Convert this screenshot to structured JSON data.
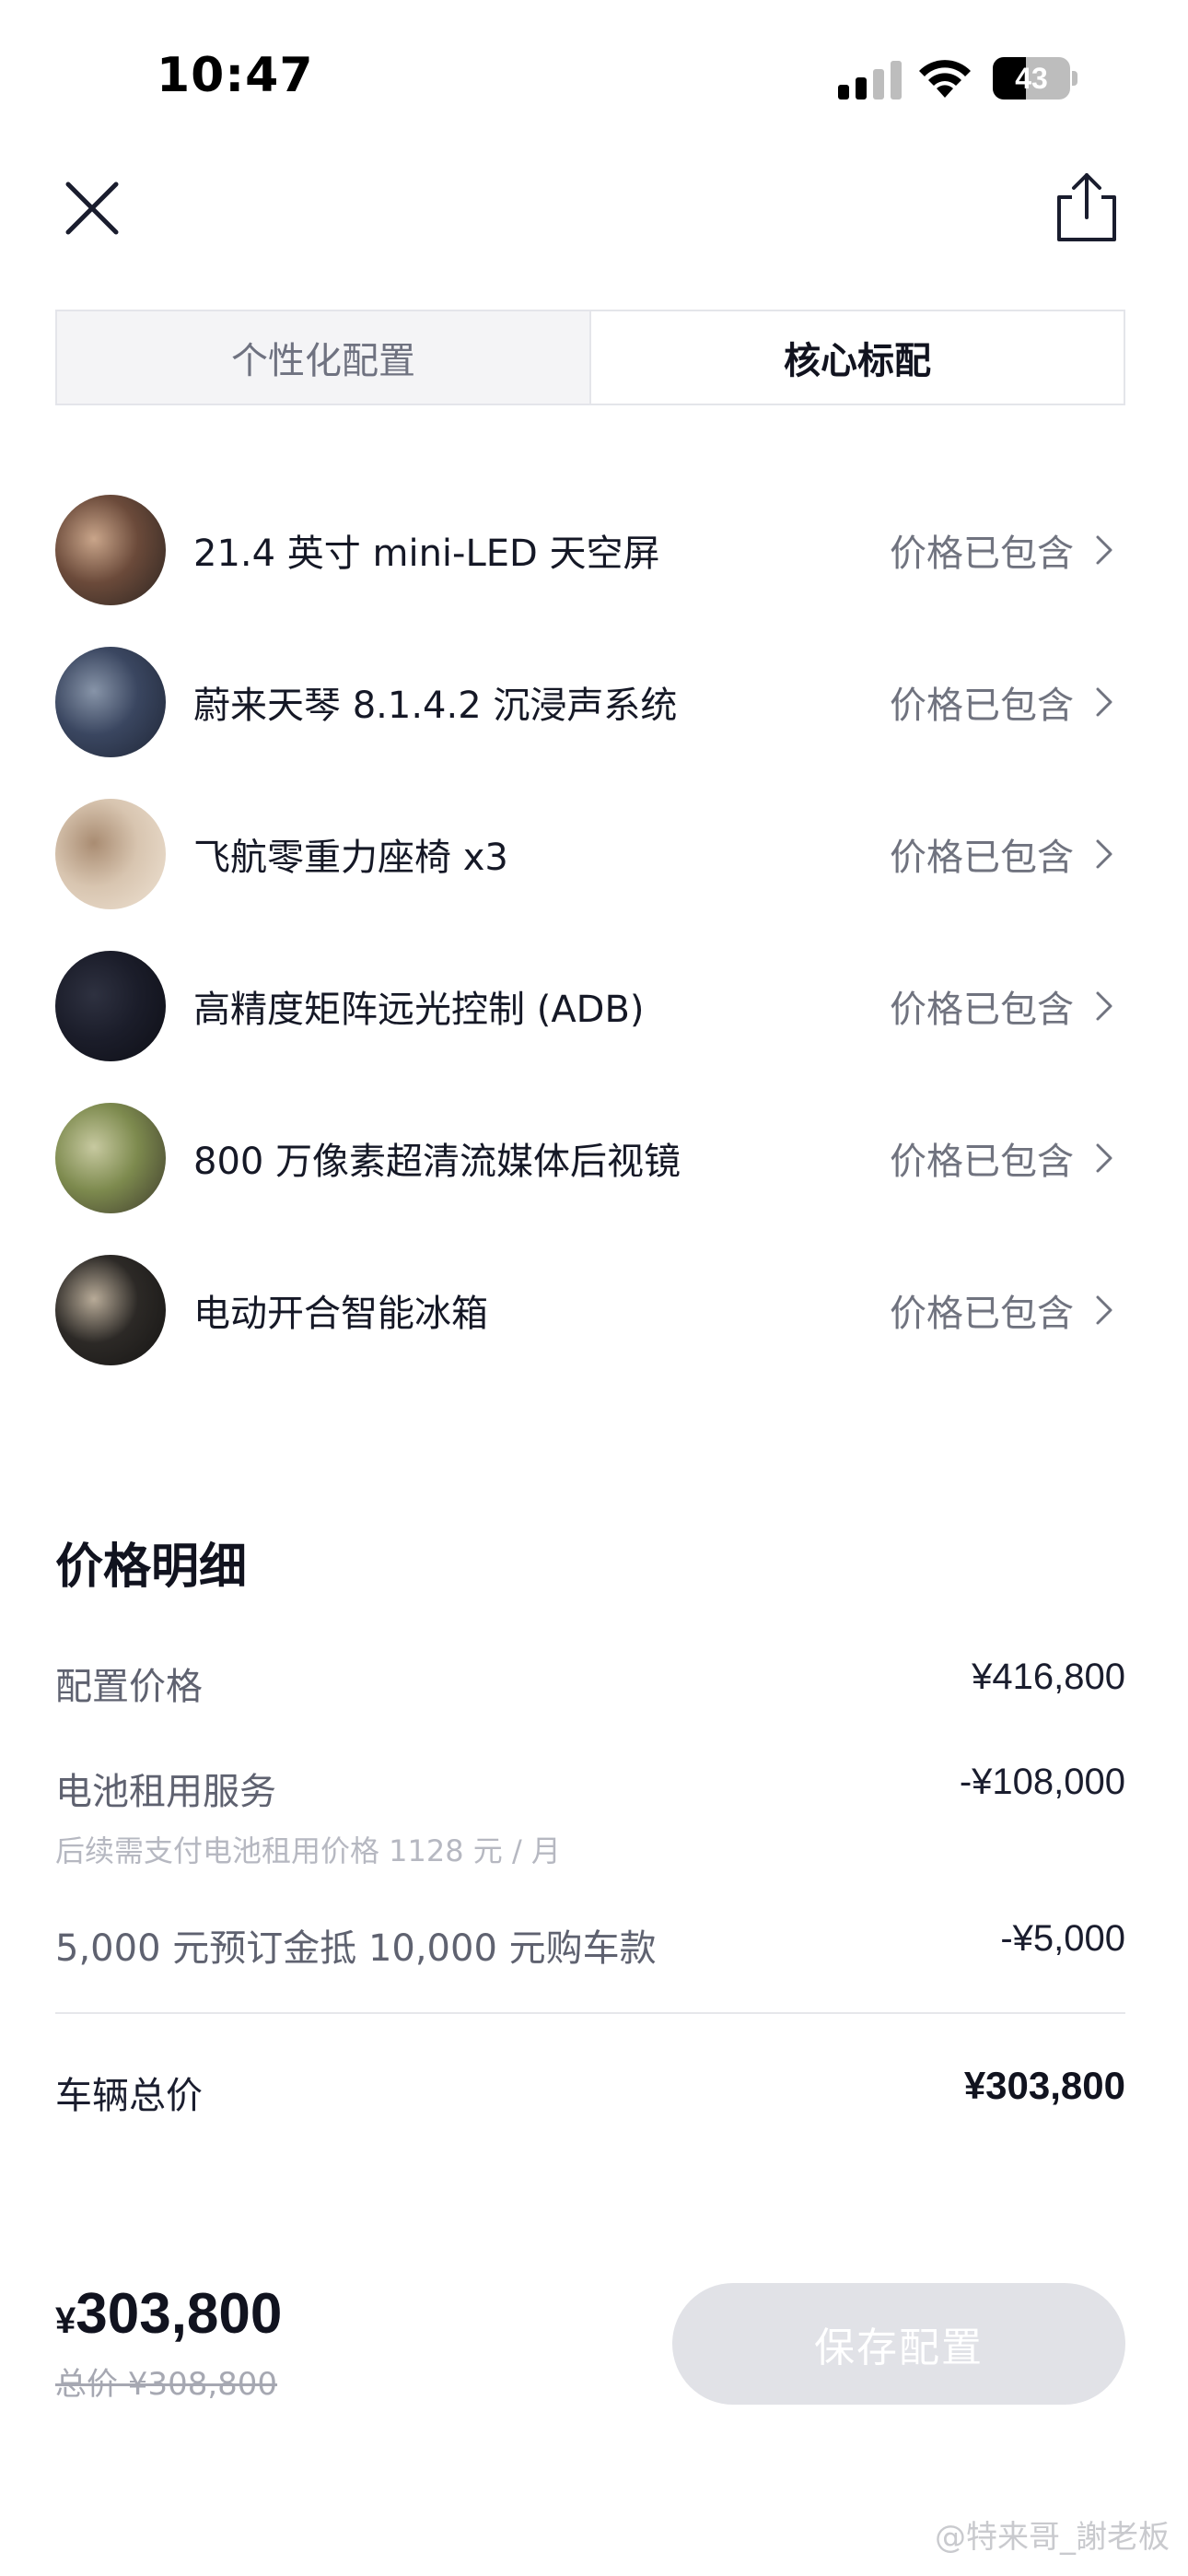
{
  "status_bar": {
    "time": "10:47",
    "battery_level": "43",
    "battery_fraction": 0.43
  },
  "nav": {
    "close_icon": "close-icon",
    "share_icon": "share-icon"
  },
  "tabs": [
    {
      "label": "个性化配置",
      "active": false
    },
    {
      "label": "核心标配",
      "active": true
    }
  ],
  "features": [
    {
      "name": "21.4 英寸 mini-LED 天空屏",
      "status": "价格已包含",
      "thumb_colors": [
        "#6b4a3a",
        "#c9a58a",
        "#2b2420"
      ]
    },
    {
      "name": "蔚来天琴 8.1.4.2 沉浸声系统",
      "status": "价格已包含",
      "thumb_colors": [
        "#3a4660",
        "#8794a8",
        "#1f2636"
      ]
    },
    {
      "name": "飞航零重力座椅 x3",
      "status": "价格已包含",
      "thumb_colors": [
        "#d8c5b0",
        "#a98c72",
        "#efe3d4"
      ]
    },
    {
      "name": "高精度矩阵远光控制 (ADB)",
      "status": "价格已包含",
      "thumb_colors": [
        "#1b1d2a",
        "#2e3140",
        "#0d0e15"
      ]
    },
    {
      "name": "800 万像素超清流媒体后视镜",
      "status": "价格已包含",
      "thumb_colors": [
        "#7d8a4e",
        "#c7c9a0",
        "#3d3a2c"
      ]
    },
    {
      "name": "电动开合智能冰箱",
      "status": "价格已包含",
      "thumb_colors": [
        "#2c2926",
        "#b8ab98",
        "#151413"
      ]
    }
  ],
  "price_detail": {
    "title": "价格明细",
    "rows": [
      {
        "label": "配置价格",
        "value": "¥416,800"
      },
      {
        "label": "电池租用服务",
        "value": "-¥108,000",
        "note": "后续需支付电池租用价格 1128 元 / 月"
      },
      {
        "label": "5,000 元预订金抵 10,000 元购车款",
        "value": "-¥5,000"
      }
    ],
    "total_label": "车辆总价",
    "total_value": "¥303,800"
  },
  "bottom_bar": {
    "currency": "¥",
    "amount": "303,800",
    "original": "总价 ¥308,800",
    "save_label": "保存配置"
  },
  "watermark": "@特来哥_謝老板",
  "colors": {
    "text_primary": "#11131f",
    "text_secondary": "#6f7280",
    "button_disabled": "#e1e2e7"
  }
}
